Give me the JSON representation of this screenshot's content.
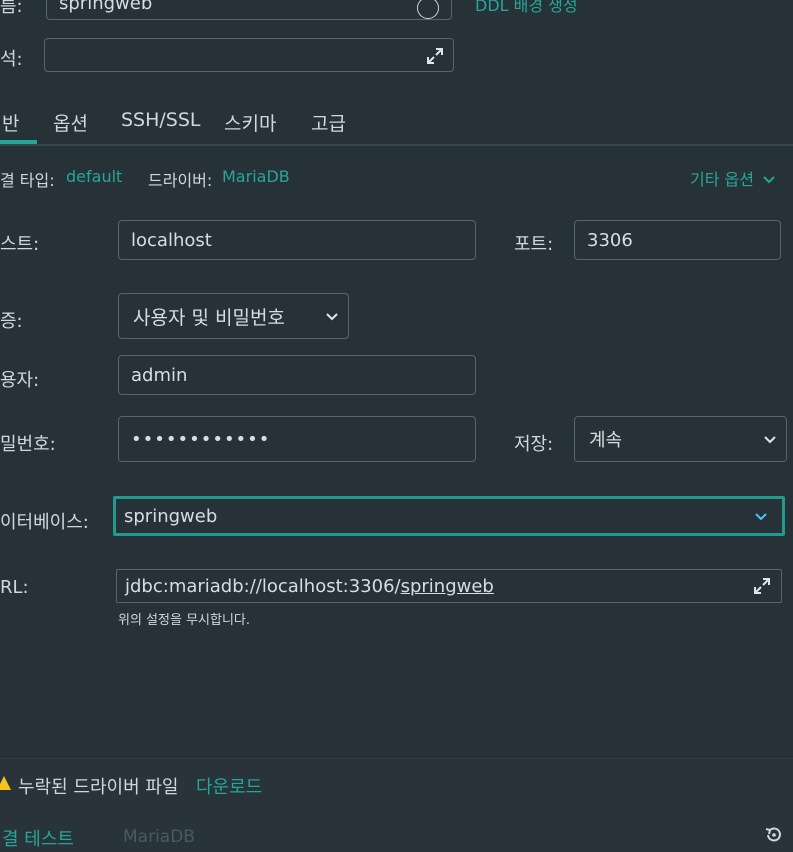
{
  "top": {
    "name_label": "름:",
    "name_value": "springweb",
    "ddl_link": "DDL 배경 생성",
    "comment_label": "석:",
    "comment_value": ""
  },
  "tabs": [
    {
      "label": "반",
      "active": true
    },
    {
      "label": "옵션"
    },
    {
      "label": "SSH/SSL"
    },
    {
      "label": "스키마"
    },
    {
      "label": "고급"
    }
  ],
  "conn_info": {
    "type_label": "결 타입:",
    "type_value": "default",
    "driver_label": "드라이버:",
    "driver_value": "MariaDB",
    "more_options": "기타 옵션"
  },
  "form": {
    "host_label": "스트:",
    "host_value": "localhost",
    "port_label": "포트:",
    "port_value": "3306",
    "auth_label": "증:",
    "auth_value": "사용자 및 비밀번호",
    "user_label": "용자:",
    "user_value": "admin",
    "password_label": "밀번호:",
    "password_value": "••••••••••••",
    "save_label": "저장:",
    "save_value": "계속",
    "database_label": "이터베이스:",
    "database_value": "springweb",
    "url_label": "RL:",
    "url_prefix": "jdbc:mariadb://localhost:3306/",
    "url_db": "springweb",
    "url_note": "위의 설정을 무시합니다."
  },
  "footer": {
    "warning_text": "누락된 드라이버 파일",
    "download_link": "다운로드",
    "test_link": "결 테스트",
    "test_driver": "MariaDB"
  },
  "colors": {
    "background": "#263238",
    "accent": "#26a69a",
    "warning": "#f5c518"
  }
}
